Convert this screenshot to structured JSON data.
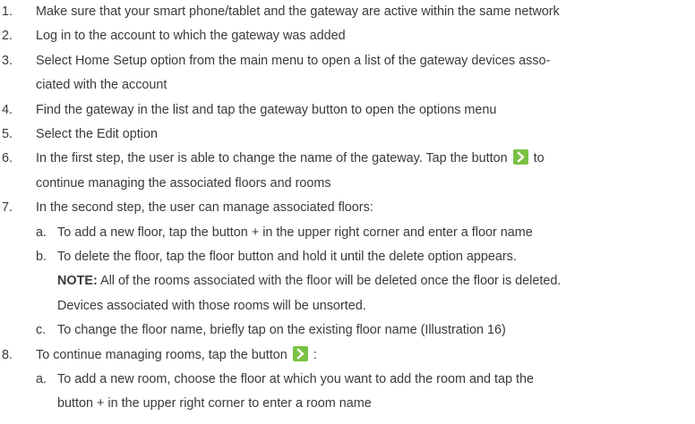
{
  "steps": [
    {
      "num": "1.",
      "text": "Make sure that your smart phone/tablet and the gateway are active within the same network"
    },
    {
      "num": "2.",
      "text": "Log in to the account to which the gateway was added"
    },
    {
      "num": "3.",
      "line1": "Select Home Setup option from the main menu to open a list of the gateway devices asso-",
      "line2": "ciated with the account"
    },
    {
      "num": "4.",
      "text": "Find the gateway in the list and tap the gateway button to open the options menu"
    },
    {
      "num": "5.",
      "text": "Select the Edit option"
    },
    {
      "num": "6.",
      "line1_before": "In the first step, the user is able to change the name of the gateway. Tap the button",
      "line1_after": "to",
      "line2": "continue managing the associated floors and rooms"
    },
    {
      "num": "7.",
      "text": "In the second step, the user can manage associated floors:"
    },
    {
      "num": "a.",
      "text": "To add a new floor, tap the button + in the upper right corner and enter a floor name"
    },
    {
      "num": "b.",
      "line1": "To delete the floor, tap the floor button and hold it until the delete option appears.",
      "note_label": "NOTE:",
      "line2": "All of the rooms associated with the floor will be deleted once the floor is deleted.",
      "line3": "Devices associated with those rooms will be unsorted."
    },
    {
      "num": "c.",
      "text": "To change the floor name, briefly tap on the existing floor name (Illustration 16)"
    },
    {
      "num": "8.",
      "before": "To continue managing rooms, tap the button",
      "after": ":"
    },
    {
      "num": "a.",
      "line1": "To add a new room, choose the floor at which you want to add the room and tap the",
      "line2": "button + in the upper right corner to enter a room name"
    }
  ],
  "colors": {
    "text": "#3a3a3a",
    "button_green": "#7ac143"
  },
  "icons": {
    "next_button": "chevron-right-icon"
  }
}
